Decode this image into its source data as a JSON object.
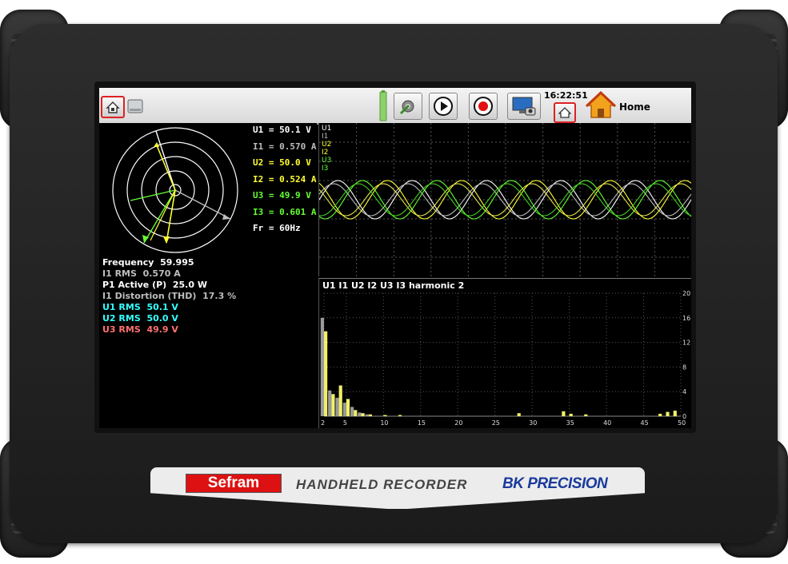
{
  "toolbar": {
    "time": "16:22:51",
    "home_label": "Home"
  },
  "readings": [
    {
      "label": "U1 = ",
      "value": "50.1 V",
      "color": "#ffffff"
    },
    {
      "label": "I1 = ",
      "value": "0.570 A",
      "color": "#bdbdbd"
    },
    {
      "label": "U2 = ",
      "value": "50.0 V",
      "color": "#ffff33"
    },
    {
      "label": "I2 = ",
      "value": "0.524 A",
      "color": "#ffff33"
    },
    {
      "label": "U3 = ",
      "value": "49.9 V",
      "color": "#66ff33"
    },
    {
      "label": "I3 = ",
      "value": "0.601 A",
      "color": "#66ff33"
    },
    {
      "label": "Fr = ",
      "value": "60Hz",
      "color": "#ffffff"
    }
  ],
  "measurements": [
    {
      "label": "Frequency",
      "value": "59.995",
      "color": "#ffffff"
    },
    {
      "label": "I1 RMS",
      "value": "0.570 A",
      "color": "#bdbdbd"
    },
    {
      "label": "P1 Active (P)",
      "value": "25.0 W",
      "color": "#ffffff"
    },
    {
      "label": "I1 Distortion (THD)",
      "value": "17.3 %",
      "color": "#bdbdbd"
    },
    {
      "label": "U1 RMS",
      "value": "50.1 V",
      "color": "#33ffff"
    },
    {
      "label": "U2 RMS",
      "value": "50.0 V",
      "color": "#33ffff"
    },
    {
      "label": "U3 RMS",
      "value": "49.9 V",
      "color": "#ff7070"
    }
  ],
  "wave_legend": [
    {
      "name": "U1",
      "color": "#ffffff"
    },
    {
      "name": "I1",
      "color": "#bdbdbd"
    },
    {
      "name": "U2",
      "color": "#ffff33"
    },
    {
      "name": "I2",
      "color": "#ffff33"
    },
    {
      "name": "U3",
      "color": "#66ff33"
    },
    {
      "name": "I3",
      "color": "#66ff33"
    }
  ],
  "harmonic_title": "U1 I1 U2 I2 U3 I3 harmonic 2",
  "chart_data": {
    "type": "bar",
    "x_ticks": [
      "2",
      "5",
      "10",
      "15",
      "20",
      "25",
      "30",
      "35",
      "40",
      "45",
      "50"
    ],
    "y_ticks": [
      "0",
      "4",
      "8",
      "12",
      "16",
      "20"
    ],
    "ylim": [
      0,
      20
    ],
    "xlim": [
      2,
      50
    ],
    "series": [
      {
        "name": "I1",
        "color": "#9a9a9a",
        "x": [
          2,
          3,
          4,
          5,
          6,
          7,
          8
        ],
        "values": [
          16,
          4.2,
          3.0,
          2.2,
          1.5,
          0.6,
          0.3
        ]
      },
      {
        "name": "U1",
        "color": "#f0f06a",
        "x": [
          2,
          3,
          4,
          5,
          6,
          7,
          8,
          10,
          12,
          28,
          34,
          35,
          37,
          47,
          48,
          49
        ],
        "values": [
          13.8,
          3.6,
          5.0,
          2.8,
          1.0,
          0.5,
          0.3,
          0.2,
          0.2,
          0.5,
          0.8,
          0.4,
          0.3,
          0.4,
          0.7,
          0.9
        ]
      }
    ]
  },
  "branding": {
    "sefram": "Sefram",
    "handheld": "HANDHELD RECORDER",
    "bk": "BK PRECISION"
  }
}
